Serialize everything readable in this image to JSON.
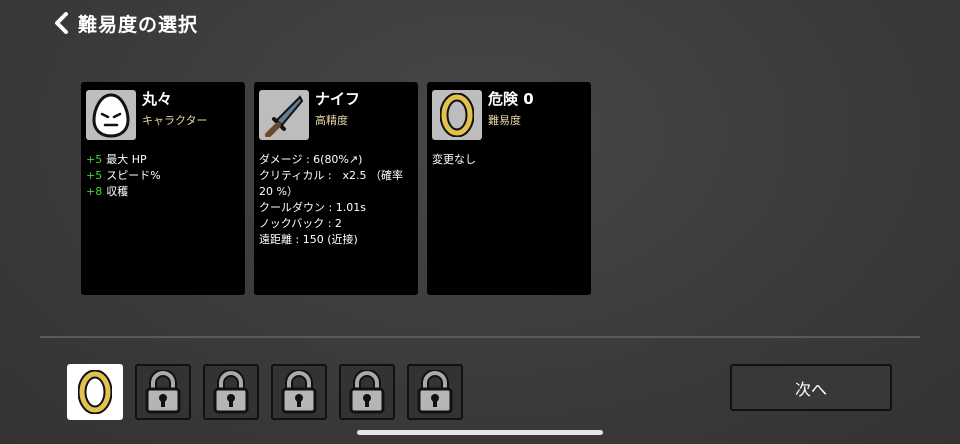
{
  "header": {
    "title": "難易度の選択",
    "back_icon": "chevron-left-icon"
  },
  "cards": [
    {
      "name": "丸々",
      "subtitle": "キャラクター",
      "icon": "egg-face-icon",
      "stats": [
        {
          "bonus": "+5",
          "text": "最大 HP"
        },
        {
          "bonus": "+5",
          "text": "スピード%"
        },
        {
          "bonus": "+8",
          "text": "収穫"
        }
      ]
    },
    {
      "name": "ナイフ",
      "subtitle": "高精度",
      "icon": "knife-icon",
      "stats": [
        {
          "text": "ダメージ : 6(80%↗)"
        },
        {
          "text": "クリティカル :　x2.5 （確率 20 %）"
        },
        {
          "text": "クールダウン : 1.01s"
        },
        {
          "text": "ノックバック : 2"
        },
        {
          "text": "遠距離 : 150 (近接)"
        }
      ]
    },
    {
      "name": "危険 0",
      "subtitle": "難易度",
      "icon": "danger-ring-icon",
      "stats": [
        {
          "text": "変更なし"
        }
      ]
    }
  ],
  "difficulty_slots": [
    {
      "icon": "danger-ring-icon",
      "state": "selected"
    },
    {
      "icon": "padlock-icon",
      "state": "locked"
    },
    {
      "icon": "padlock-icon",
      "state": "locked"
    },
    {
      "icon": "padlock-icon",
      "state": "locked"
    },
    {
      "icon": "padlock-icon",
      "state": "locked"
    },
    {
      "icon": "padlock-icon",
      "state": "locked"
    }
  ],
  "next_button": {
    "label": "次へ"
  },
  "colors": {
    "bonus": "#3fd93f",
    "subtitle": "#e8d9a8",
    "ring_gold": "#e2c24e"
  }
}
